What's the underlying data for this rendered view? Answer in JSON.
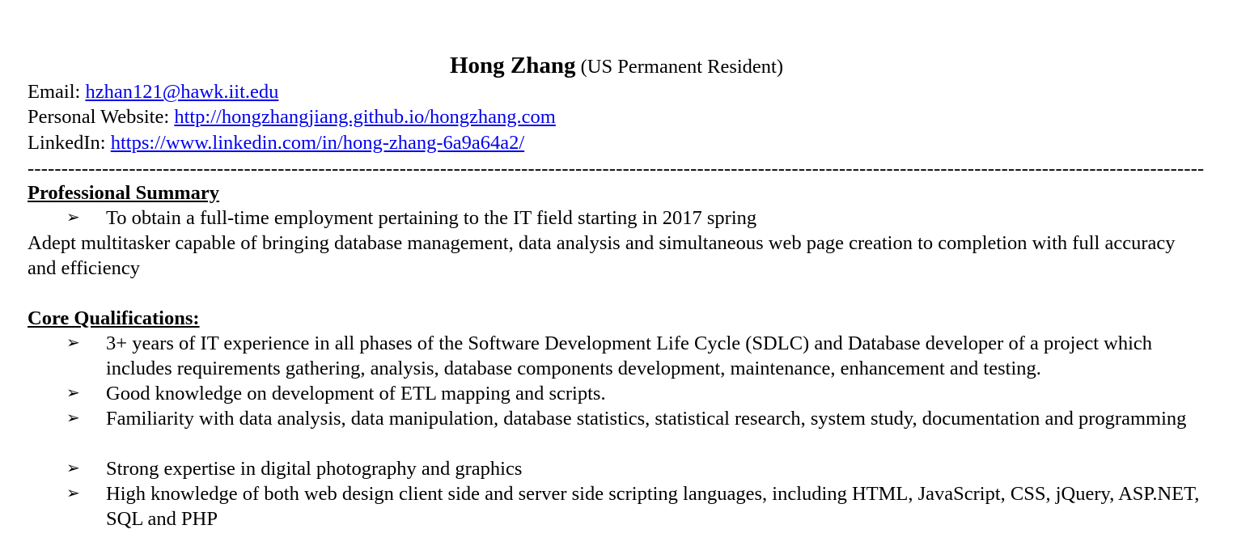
{
  "header": {
    "name": "Hong Zhang",
    "status": "(US Permanent Resident)"
  },
  "contact": {
    "email_label": "Email: ",
    "email": "hzhan121@hawk.iit.edu",
    "website_label": "Personal Website: ",
    "website": "http://hongzhangjiang.github.io/hongzhang.com",
    "linkedin_label": "LinkedIn: ",
    "linkedin": "https://www.linkedin.com/in/hong-zhang-6a9a64a2/"
  },
  "divider": "------------------------------------------------------------------------------------------------------------------------------------------------------------------------------------------------------------------------------",
  "summary": {
    "heading": "Professional Summary",
    "bullet": "To obtain a full-time employment pertaining to the IT field starting in 2017 spring",
    "paragraph": "Adept multitasker capable of bringing database management, data analysis and simultaneous web page creation to completion with full accuracy and efficiency"
  },
  "qualifications": {
    "heading": "Core Qualifications:",
    "items": [
      "3+ years of IT experience in all phases of the Software Development Life Cycle (SDLC) and Database developer of a project which includes requirements gathering, analysis, database components development, maintenance, enhancement and testing.",
      "Good knowledge on development of ETL mapping and scripts.",
      "Familiarity with data analysis, data manipulation, database statistics, statistical research, system study, documentation and programming",
      "Strong expertise in digital photography and graphics",
      "High knowledge of both web design client side and server side scripting languages, including HTML, JavaScript, CSS, jQuery, ASP.NET, SQL and PHP"
    ]
  },
  "bullet_glyph": "➢"
}
